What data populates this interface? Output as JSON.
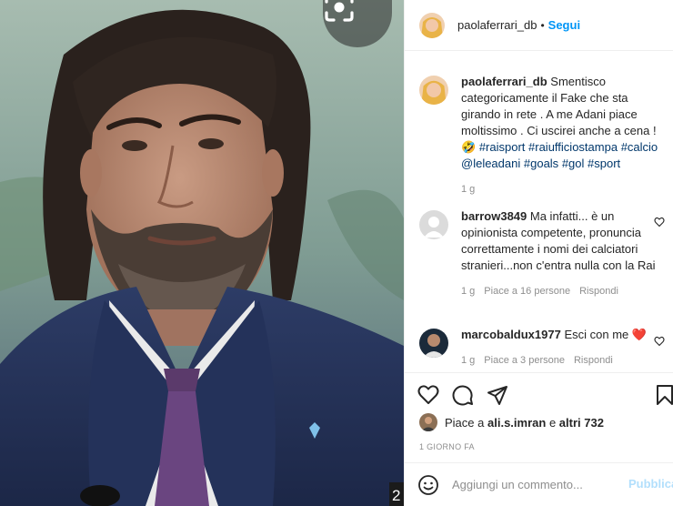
{
  "post": {
    "author": "paolaferrari_db",
    "separator": "•",
    "follow_label": "Segui"
  },
  "caption": {
    "username": "paolaferrari_db",
    "text": "Smentisco categoricamente il Fake che sta girando in rete . A me Adani piace moltissimo . Ci uscirei anche a cena !",
    "emoji": "🤣",
    "hashtags": [
      "#raisport",
      "#raiufficiostampa",
      "#calcio",
      "@leleadani",
      "#goals",
      "#gol",
      "#sport"
    ],
    "time": "1 g"
  },
  "comments": [
    {
      "username": "barrow3849",
      "text": "Ma infatti... è un opinionista competente, pronuncia correttamente i nomi dei calciatori stranieri...non c'entra nulla con la Rai",
      "time": "1 g",
      "likes": "Piace a 16 persone",
      "reply": "Rispondi"
    },
    {
      "username": "marcobaldux1977",
      "text": "Esci con me",
      "emoji": "❤️",
      "time": "1 g",
      "likes": "Piace a 3 persone",
      "reply": "Rispondi"
    }
  ],
  "likes_line": {
    "prefix": "Piace a",
    "user": "ali.s.imran",
    "connector": "e",
    "others": "altri 732"
  },
  "date": "1 GIORNO FA",
  "add_comment": {
    "placeholder": "Aggiungi un commento...",
    "publish_label": "Pubblica"
  },
  "carousel_index": "2",
  "icons": {
    "lens": "lens-icon",
    "like": "heart-icon",
    "comment": "comment-icon",
    "share": "paper-plane-icon",
    "save": "bookmark-icon",
    "emoji": "smiley-icon",
    "heart_small": "heart-outline-icon"
  },
  "colors": {
    "accent": "#0095f6",
    "link": "#00376b",
    "muted": "#8e8e8e",
    "heart_red": "#ed4956"
  }
}
